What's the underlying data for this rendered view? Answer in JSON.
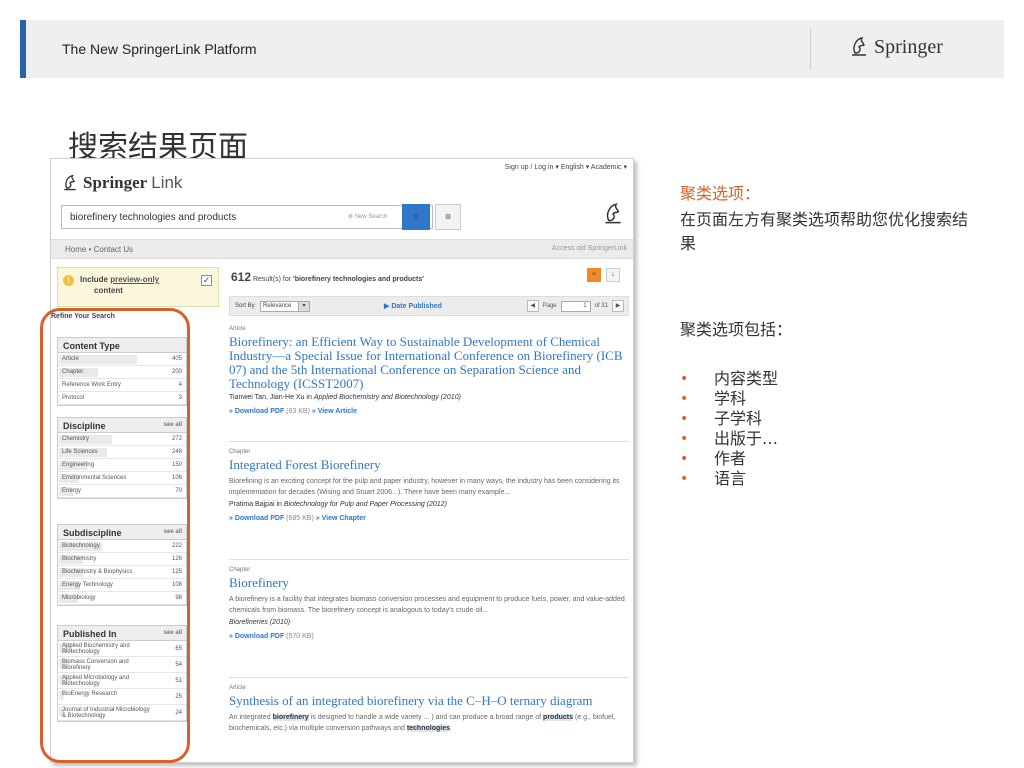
{
  "slide": {
    "header_title": "The New SpringerLink Platform",
    "brand": "Springer",
    "title": "搜索结果页面"
  },
  "site": {
    "topnav": "Sign up / Log in ▾   English ▾   Academic ▾",
    "logo_bold": "Springer",
    "logo_light": "Link",
    "search_value": "biorefinery technologies and products",
    "new_search": "New Search",
    "nav_home": "Home   •   Contact Us",
    "nav_old": "Access old SpringerLink"
  },
  "left": {
    "preview_text_1": "Include ",
    "preview_link": "preview-only",
    "preview_text_2": "content",
    "refine": "Refine Your Search",
    "see_all": "see all",
    "facets": [
      {
        "title": "Content Type",
        "rows": [
          [
            "Article",
            "405",
            0.62
          ],
          [
            "Chapter",
            "200",
            0.31
          ],
          [
            "Reference Work Entry",
            "4",
            0.01
          ],
          [
            "Protocol",
            "3",
            0.01
          ]
        ]
      },
      {
        "title": "Discipline",
        "rows": [
          [
            "Chemistry",
            "272",
            0.42
          ],
          [
            "Life Sciences",
            "248",
            0.38
          ],
          [
            "Engineering",
            "150",
            0.23
          ],
          [
            "Environmental Sciences",
            "106",
            0.16
          ],
          [
            "Energy",
            "70",
            0.11
          ]
        ]
      },
      {
        "title": "Subdiscipline",
        "rows": [
          [
            "Biotechnology",
            "222",
            0.34
          ],
          [
            "Biochemistry",
            "126",
            0.19
          ],
          [
            "Biochemistry & Biophysics",
            "125",
            0.19
          ],
          [
            "Energy Technology",
            "108",
            0.17
          ],
          [
            "Microbiology",
            "98",
            0.15
          ]
        ]
      },
      {
        "title": "Published In",
        "rows": [
          [
            "Applied Biochemistry and Biotechnology",
            "65",
            0.1
          ],
          [
            "Biomass Conversion and Biorefinery",
            "54",
            0.08
          ],
          [
            "Applied Microbiology and Biotechnology",
            "51",
            0.08
          ],
          [
            "BioEnergy Research",
            "25",
            0.04
          ],
          [
            "Journal of Industrial Microbiology & Biotechnology",
            "24",
            0.04
          ]
        ]
      }
    ]
  },
  "results": {
    "count": "612",
    "count_text": " Result(s) for ",
    "query": "'biorefinery technologies and products'",
    "sort_by": "Sort By",
    "sort_value": "Relevance",
    "date_published": "▶ Date Published",
    "page_label": "Page",
    "page_value": "1",
    "page_of": "of 31",
    "items": [
      {
        "type": "Article",
        "title": "Biorefinery: an Efficient Way to Sustainable Development of Chemical Industry—a Special Issue for International Conference on Biorefinery (ICB 07) and the 5th International Conference on Separation Science and Technology (ICSST2007)",
        "authors": "Tianwei Tan, Jian-He Xu in ",
        "source": "Applied Biochemistry and Biotechnology (2010)",
        "desc": "",
        "links": "» Download PDF",
        "size": " (63 KB) ",
        "links2": "» View Article"
      },
      {
        "type": "Chapter",
        "title": "Integrated Forest Biorefinery",
        "authors": "Pratima Bajpai in ",
        "source": "Biotechnology for Pulp and Paper Processing (2012)",
        "desc": "Biorefining is an exciting concept for the pulp and paper industry, however in many ways, the industry has been considering its implementation for decades (Wising and Stuart 2006...). There have been many example...",
        "links": "» Download PDF",
        "size": " (685 KB) ",
        "links2": "» View Chapter"
      },
      {
        "type": "Chapter",
        "title": "Biorefinery",
        "authors": "",
        "source": "Biorefineries (2010)",
        "desc": "A biorefinery is a facility that integrates biomass conversion processes and equipment to produce fuels, power, and value-added chemicals from biomass. The biorefinery concept is analogous to today's crude oil...",
        "links": "» Download PDF",
        "size": " (570 KB)",
        "links2": ""
      },
      {
        "type": "Article",
        "title": "Synthesis of an integrated biorefinery via the C–H–O ternary diagram",
        "authors": "",
        "source": "",
        "desc_a": "An integrated ",
        "desc_h1": "biorefinery",
        "desc_b": " is designed to handle a wide variety ... ) and can produce a broad range of ",
        "desc_h2": "products",
        "desc_c": " (e.g., biofuel, biochemicals, etc.) via multiple conversion pathways and ",
        "desc_h3": "technologies",
        "desc_d": "."
      }
    ]
  },
  "notes": {
    "heading": "聚类选项：",
    "para": "在页面左方有聚类选项帮助您优化搜索结果",
    "list_intro": "聚类选项包括：",
    "list": [
      "内容类型",
      "学科",
      "子学科",
      "出版于…",
      "作者",
      "语言"
    ]
  },
  "colors": {
    "accent": "#d4622a",
    "link": "#2f76c8",
    "header_bar": "#2a63a8"
  }
}
